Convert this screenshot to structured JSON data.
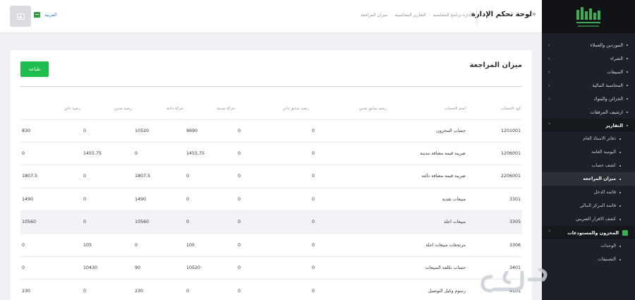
{
  "header": {
    "page_title": "لوحة تحكم الإدارة",
    "collapse_icon": "«",
    "breadcrumbs": [
      "إدارة برنامج المحاسبة",
      "التقارير المحاسبية",
      "ميزان المراجعة"
    ],
    "language": "العربية"
  },
  "sidebar": {
    "items": [
      {
        "label": "الموردين والعملاء",
        "type": "item",
        "chevron": "‹"
      },
      {
        "label": "الشراء",
        "type": "item",
        "chevron": "‹"
      },
      {
        "label": "المبيعات",
        "type": "item",
        "chevron": "‹"
      },
      {
        "label": "المحاسبة المالية",
        "type": "item",
        "chevron": "‹"
      },
      {
        "label": "الخزائن والبنوك",
        "type": "item",
        "chevron": "‹"
      },
      {
        "label": "ارشيف المرفقات",
        "type": "item",
        "chevron": ""
      },
      {
        "label": "التقارير",
        "type": "section",
        "chevron": "˅"
      },
      {
        "label": "دفاتر الاستاذ العام",
        "type": "sub",
        "chevron": ""
      },
      {
        "label": "اليومية العامة",
        "type": "sub",
        "chevron": ""
      },
      {
        "label": "كشف حساب",
        "type": "sub",
        "chevron": ""
      },
      {
        "label": "ميزان المراجعة",
        "type": "active",
        "chevron": ""
      },
      {
        "label": "قائمة الدخل",
        "type": "sub",
        "chevron": ""
      },
      {
        "label": "قائمة المركز المالي",
        "type": "sub",
        "chevron": ""
      },
      {
        "label": "كشف الاقرار الضريبي",
        "type": "sub",
        "chevron": ""
      },
      {
        "label": "المخزون والمستودعات",
        "type": "section",
        "chevron": "˅"
      },
      {
        "label": "الوحدات",
        "type": "sub",
        "chevron": ""
      },
      {
        "label": "التصنيفات",
        "type": "sub",
        "chevron": ""
      }
    ]
  },
  "card": {
    "title": "ميزان المراجعة",
    "print_label": "طباعة"
  },
  "table": {
    "headers": [
      "كود الحساب",
      "اسم الحساب",
      "رصيد سابق مدين",
      "رصيد سابق دائن",
      "حركة مدينة",
      "حركة دائنة",
      "رصيد مدين",
      "رصيد دائن"
    ],
    "rows": [
      [
        "1201001",
        "حساب المخزون",
        "0",
        "0",
        "9690",
        "10520",
        "0",
        "830"
      ],
      [
        "1206001",
        "ضريبة قيمة مضافة مدينة",
        "0",
        "0",
        "1455.75",
        "0",
        "1455.75",
        "0"
      ],
      [
        "2206001",
        "ضريبة قيمة مضافة دائنة",
        "0",
        "0",
        "0",
        "1807.5",
        "0",
        "1807.5"
      ],
      [
        "3301",
        "مبيعات نقدية",
        "0",
        "0",
        "0",
        "1490",
        "0",
        "1490"
      ],
      [
        "3305",
        "مبيعات اجلة",
        "0",
        "0",
        "0",
        "10560",
        "0",
        "10560"
      ],
      [
        "3306",
        "مرتجعات مبيعات اجلة",
        "0",
        "0",
        "105",
        "0",
        "105",
        "0"
      ],
      [
        "3401",
        "حساب تكلفة المبيعات",
        "0",
        "0",
        "10520",
        "90",
        "10430",
        "0"
      ],
      [
        "4101",
        "رسوم وكيل التوصيل",
        "0",
        "0",
        "0",
        "230",
        "0",
        "230"
      ]
    ],
    "highlighted_row": 4
  },
  "colors": {
    "sidebar_bg": "#1c2027",
    "accent_green": "#1fbd4e",
    "link_blue": "#2d7fd3"
  }
}
